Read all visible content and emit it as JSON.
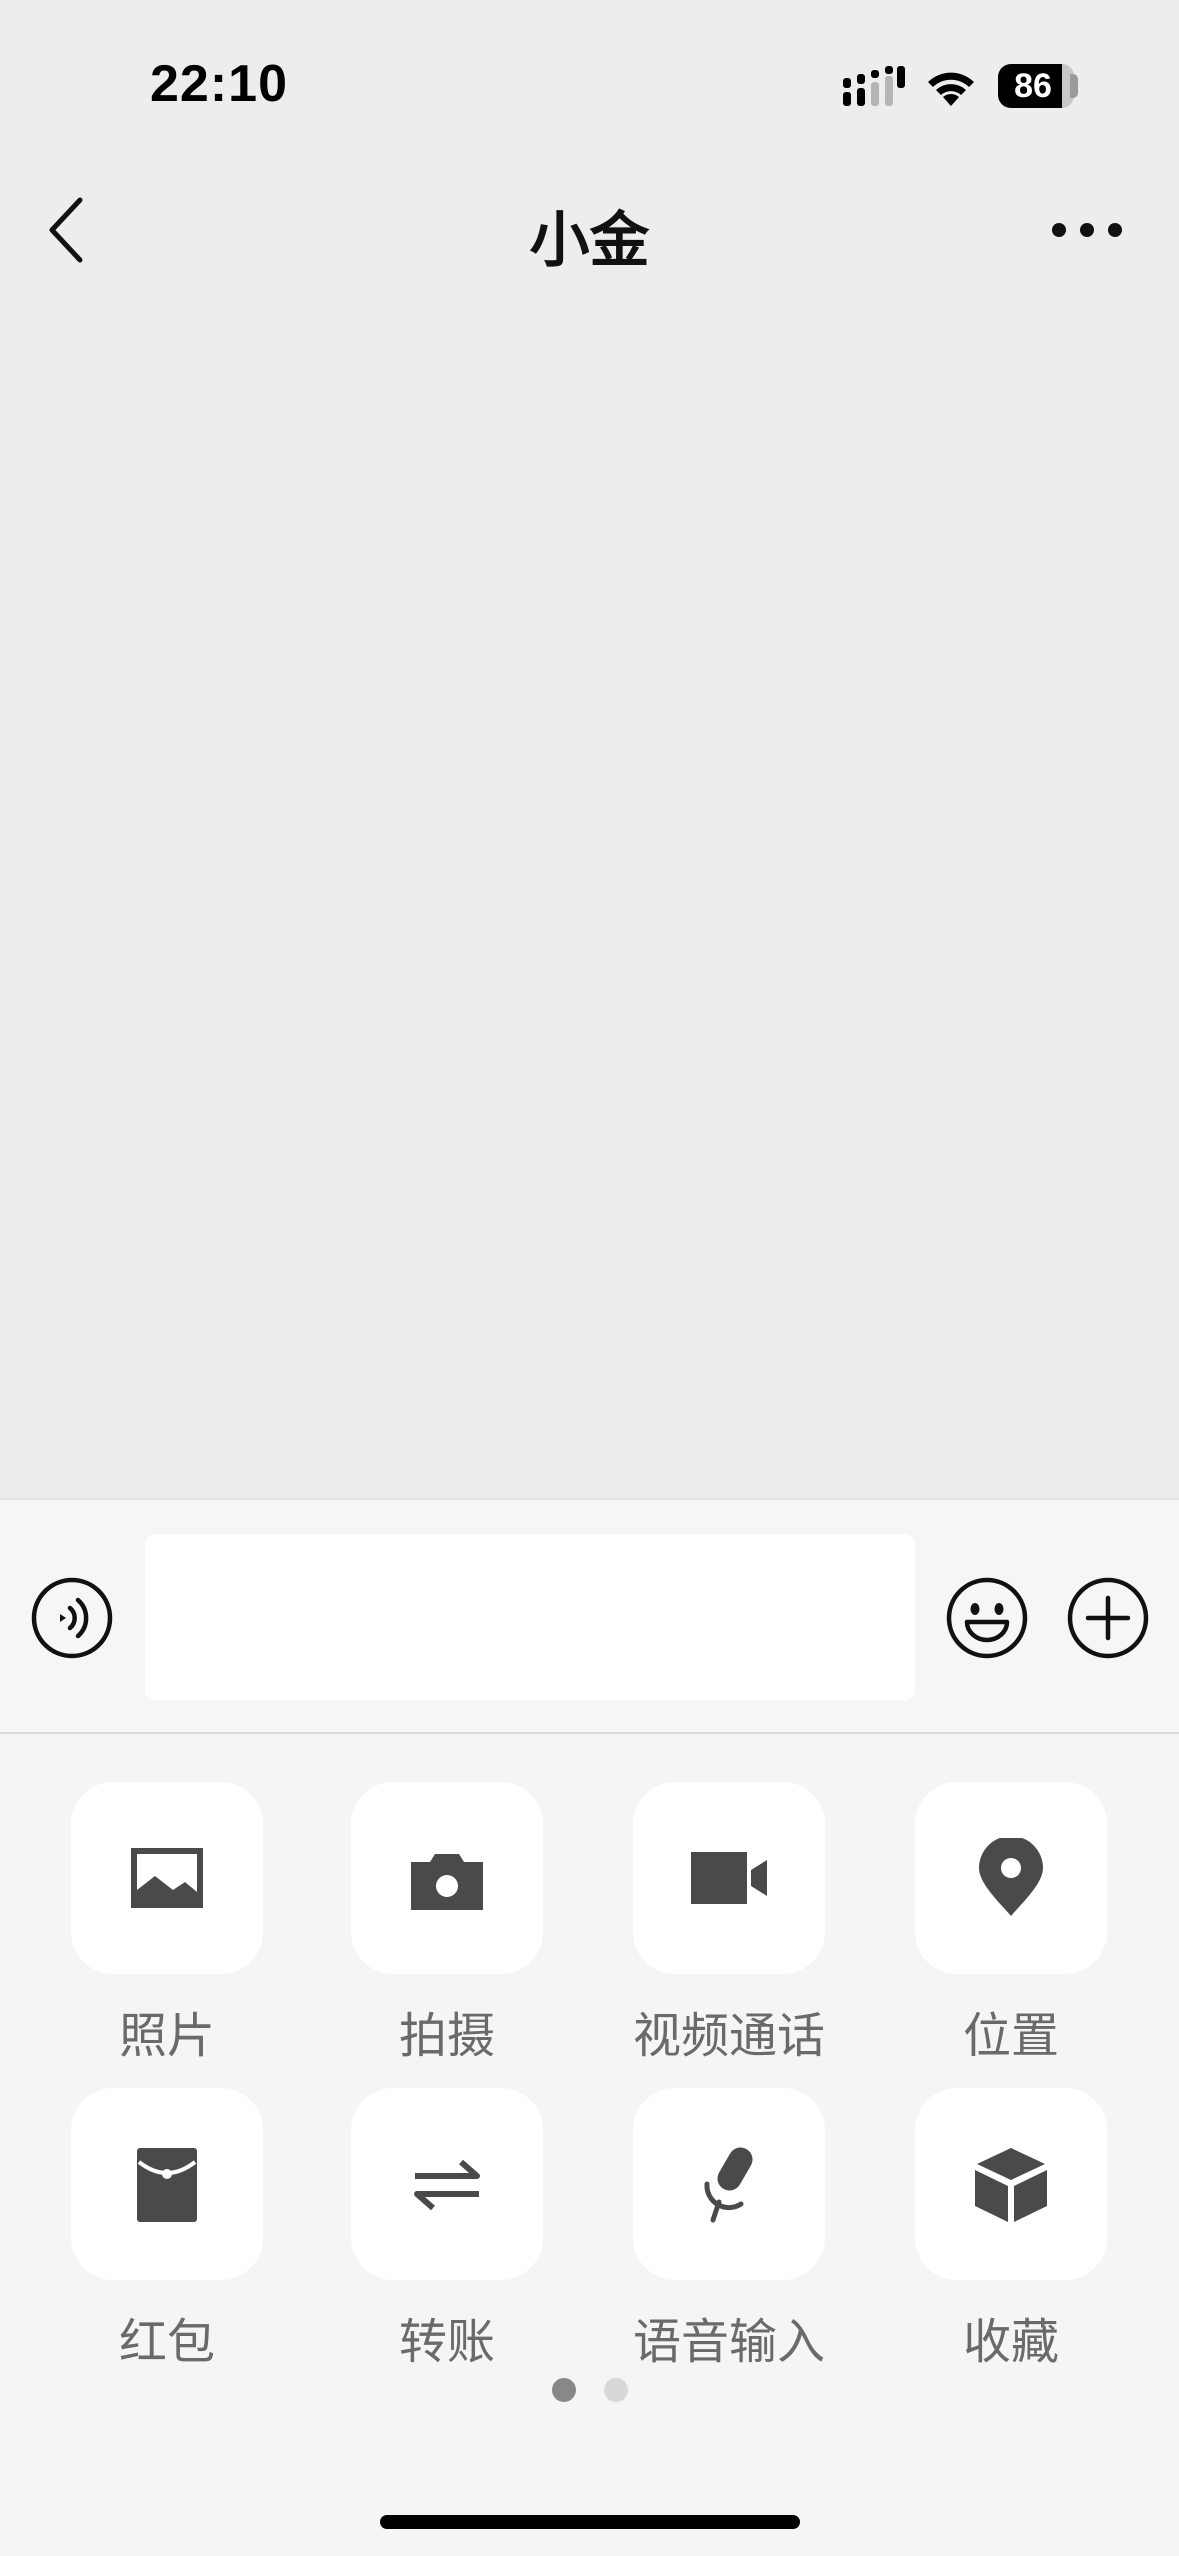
{
  "status_bar": {
    "time": "22:10",
    "battery": "86",
    "icons": [
      "signal-icon",
      "wifi-icon",
      "battery-icon"
    ]
  },
  "nav": {
    "title": "小金",
    "icons": [
      "back-icon",
      "more-icon"
    ]
  },
  "input_bar": {
    "placeholder": "",
    "icons": [
      "voice-icon",
      "emoji-icon",
      "plus-icon"
    ]
  },
  "more_panel": {
    "items": [
      {
        "label": "照片",
        "icon": "photo-icon"
      },
      {
        "label": "拍摄",
        "icon": "camera-icon"
      },
      {
        "label": "视频通话",
        "icon": "video-call-icon"
      },
      {
        "label": "位置",
        "icon": "location-icon"
      },
      {
        "label": "红包",
        "icon": "red-packet-icon"
      },
      {
        "label": "转账",
        "icon": "transfer-icon"
      },
      {
        "label": "语音输入",
        "icon": "microphone-icon"
      },
      {
        "label": "收藏",
        "icon": "favorites-icon"
      }
    ],
    "page_count": 2,
    "active_page": 1
  },
  "colors": {
    "background": "#ededed",
    "panel": "#f5f5f5",
    "icon": "#4a4a4a",
    "label": "#6a6a6a"
  }
}
